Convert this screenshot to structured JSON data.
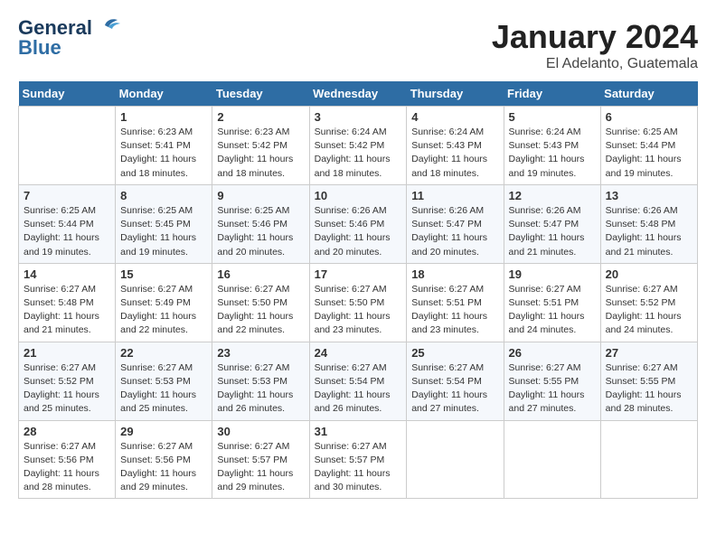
{
  "logo": {
    "line1": "General",
    "line2": "Blue"
  },
  "title": "January 2024",
  "location": "El Adelanto, Guatemala",
  "days_of_week": [
    "Sunday",
    "Monday",
    "Tuesday",
    "Wednesday",
    "Thursday",
    "Friday",
    "Saturday"
  ],
  "weeks": [
    [
      {
        "day": "",
        "info": ""
      },
      {
        "day": "1",
        "info": "Sunrise: 6:23 AM\nSunset: 5:41 PM\nDaylight: 11 hours and 18 minutes."
      },
      {
        "day": "2",
        "info": "Sunrise: 6:23 AM\nSunset: 5:42 PM\nDaylight: 11 hours and 18 minutes."
      },
      {
        "day": "3",
        "info": "Sunrise: 6:24 AM\nSunset: 5:42 PM\nDaylight: 11 hours and 18 minutes."
      },
      {
        "day": "4",
        "info": "Sunrise: 6:24 AM\nSunset: 5:43 PM\nDaylight: 11 hours and 18 minutes."
      },
      {
        "day": "5",
        "info": "Sunrise: 6:24 AM\nSunset: 5:43 PM\nDaylight: 11 hours and 19 minutes."
      },
      {
        "day": "6",
        "info": "Sunrise: 6:25 AM\nSunset: 5:44 PM\nDaylight: 11 hours and 19 minutes."
      }
    ],
    [
      {
        "day": "7",
        "info": "Sunrise: 6:25 AM\nSunset: 5:44 PM\nDaylight: 11 hours and 19 minutes."
      },
      {
        "day": "8",
        "info": "Sunrise: 6:25 AM\nSunset: 5:45 PM\nDaylight: 11 hours and 19 minutes."
      },
      {
        "day": "9",
        "info": "Sunrise: 6:25 AM\nSunset: 5:46 PM\nDaylight: 11 hours and 20 minutes."
      },
      {
        "day": "10",
        "info": "Sunrise: 6:26 AM\nSunset: 5:46 PM\nDaylight: 11 hours and 20 minutes."
      },
      {
        "day": "11",
        "info": "Sunrise: 6:26 AM\nSunset: 5:47 PM\nDaylight: 11 hours and 20 minutes."
      },
      {
        "day": "12",
        "info": "Sunrise: 6:26 AM\nSunset: 5:47 PM\nDaylight: 11 hours and 21 minutes."
      },
      {
        "day": "13",
        "info": "Sunrise: 6:26 AM\nSunset: 5:48 PM\nDaylight: 11 hours and 21 minutes."
      }
    ],
    [
      {
        "day": "14",
        "info": "Sunrise: 6:27 AM\nSunset: 5:48 PM\nDaylight: 11 hours and 21 minutes."
      },
      {
        "day": "15",
        "info": "Sunrise: 6:27 AM\nSunset: 5:49 PM\nDaylight: 11 hours and 22 minutes."
      },
      {
        "day": "16",
        "info": "Sunrise: 6:27 AM\nSunset: 5:50 PM\nDaylight: 11 hours and 22 minutes."
      },
      {
        "day": "17",
        "info": "Sunrise: 6:27 AM\nSunset: 5:50 PM\nDaylight: 11 hours and 23 minutes."
      },
      {
        "day": "18",
        "info": "Sunrise: 6:27 AM\nSunset: 5:51 PM\nDaylight: 11 hours and 23 minutes."
      },
      {
        "day": "19",
        "info": "Sunrise: 6:27 AM\nSunset: 5:51 PM\nDaylight: 11 hours and 24 minutes."
      },
      {
        "day": "20",
        "info": "Sunrise: 6:27 AM\nSunset: 5:52 PM\nDaylight: 11 hours and 24 minutes."
      }
    ],
    [
      {
        "day": "21",
        "info": "Sunrise: 6:27 AM\nSunset: 5:52 PM\nDaylight: 11 hours and 25 minutes."
      },
      {
        "day": "22",
        "info": "Sunrise: 6:27 AM\nSunset: 5:53 PM\nDaylight: 11 hours and 25 minutes."
      },
      {
        "day": "23",
        "info": "Sunrise: 6:27 AM\nSunset: 5:53 PM\nDaylight: 11 hours and 26 minutes."
      },
      {
        "day": "24",
        "info": "Sunrise: 6:27 AM\nSunset: 5:54 PM\nDaylight: 11 hours and 26 minutes."
      },
      {
        "day": "25",
        "info": "Sunrise: 6:27 AM\nSunset: 5:54 PM\nDaylight: 11 hours and 27 minutes."
      },
      {
        "day": "26",
        "info": "Sunrise: 6:27 AM\nSunset: 5:55 PM\nDaylight: 11 hours and 27 minutes."
      },
      {
        "day": "27",
        "info": "Sunrise: 6:27 AM\nSunset: 5:55 PM\nDaylight: 11 hours and 28 minutes."
      }
    ],
    [
      {
        "day": "28",
        "info": "Sunrise: 6:27 AM\nSunset: 5:56 PM\nDaylight: 11 hours and 28 minutes."
      },
      {
        "day": "29",
        "info": "Sunrise: 6:27 AM\nSunset: 5:56 PM\nDaylight: 11 hours and 29 minutes."
      },
      {
        "day": "30",
        "info": "Sunrise: 6:27 AM\nSunset: 5:57 PM\nDaylight: 11 hours and 29 minutes."
      },
      {
        "day": "31",
        "info": "Sunrise: 6:27 AM\nSunset: 5:57 PM\nDaylight: 11 hours and 30 minutes."
      },
      {
        "day": "",
        "info": ""
      },
      {
        "day": "",
        "info": ""
      },
      {
        "day": "",
        "info": ""
      }
    ]
  ]
}
